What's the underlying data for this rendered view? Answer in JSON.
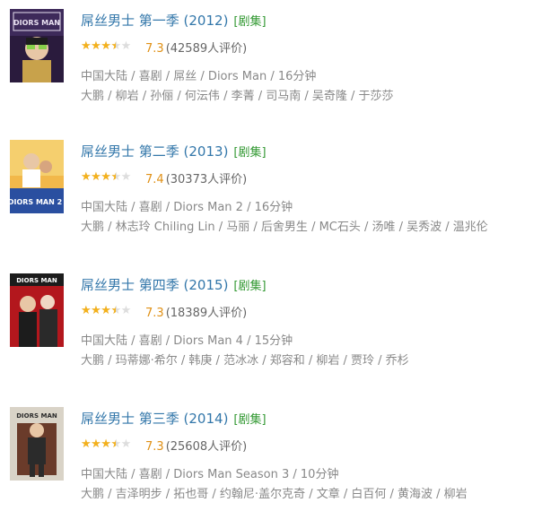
{
  "results": [
    {
      "title": "屌丝男士 第一季 (2012)",
      "tag": "[剧集]",
      "rating": 7.3,
      "rating_text": "7.3",
      "votes": "(42589人评价)",
      "meta": "中国大陆 / 喜剧 / 屌丝 / Diors Man / 16分钟",
      "cast": "大鹏 / 柳岩 / 孙俪 / 何沄伟 / 李菁 / 司马南 / 吴奇隆 / 于莎莎",
      "poster_text": "DIORS MAN",
      "poster_colors": [
        "#2a1b3d",
        "#c8a24b",
        "#e8e0f0"
      ]
    },
    {
      "title": "屌丝男士 第二季 (2013)",
      "tag": "[剧集]",
      "rating": 7.4,
      "rating_text": "7.4",
      "votes": "(30373人评价)",
      "meta": "中国大陆 / 喜剧 / Diors Man 2 / 16分钟",
      "cast": "大鹏 / 林志玲 Chiling Lin / 马丽 / 后舍男生 / MC石头 / 汤唯 / 吴秀波 / 温兆伦",
      "poster_text": "DIORS MAN 2",
      "poster_colors": [
        "#f2b84a",
        "#2a4fa0",
        "#ffffff"
      ]
    },
    {
      "title": "屌丝男士 第四季 (2015)",
      "tag": "[剧集]",
      "rating": 7.3,
      "rating_text": "7.3",
      "votes": "(18389人评价)",
      "meta": "中国大陆 / 喜剧 / Diors Man 4 / 15分钟",
      "cast": "大鹏 / 玛蒂娜·希尔 / 韩庚 / 范冰冰 / 郑容和 / 柳岩 / 贾玲 / 乔杉",
      "poster_text": "DIORS MAN",
      "poster_colors": [
        "#b3171d",
        "#1c1c1c",
        "#f0d7c4"
      ]
    },
    {
      "title": "屌丝男士 第三季 (2014)",
      "tag": "[剧集]",
      "rating": 7.3,
      "rating_text": "7.3",
      "votes": "(25608人评价)",
      "meta": "中国大陆 / 喜剧 / Diors Man Season 3 / 10分钟",
      "cast": "大鹏 / 吉泽明步 / 拓也哥 / 约翰尼·盖尔克奇 / 文章 / 白百何 / 黄海波 / 柳岩",
      "poster_text": "DIORS MAN",
      "poster_colors": [
        "#d9d3c7",
        "#6a3b2a",
        "#2b2b2b"
      ]
    }
  ],
  "colors": {
    "title_link": "#3377aa",
    "tag": "#339933",
    "star_fill": "#f4b11c",
    "star_empty": "#dddddd",
    "score": "#e09015",
    "meta": "#888888"
  }
}
